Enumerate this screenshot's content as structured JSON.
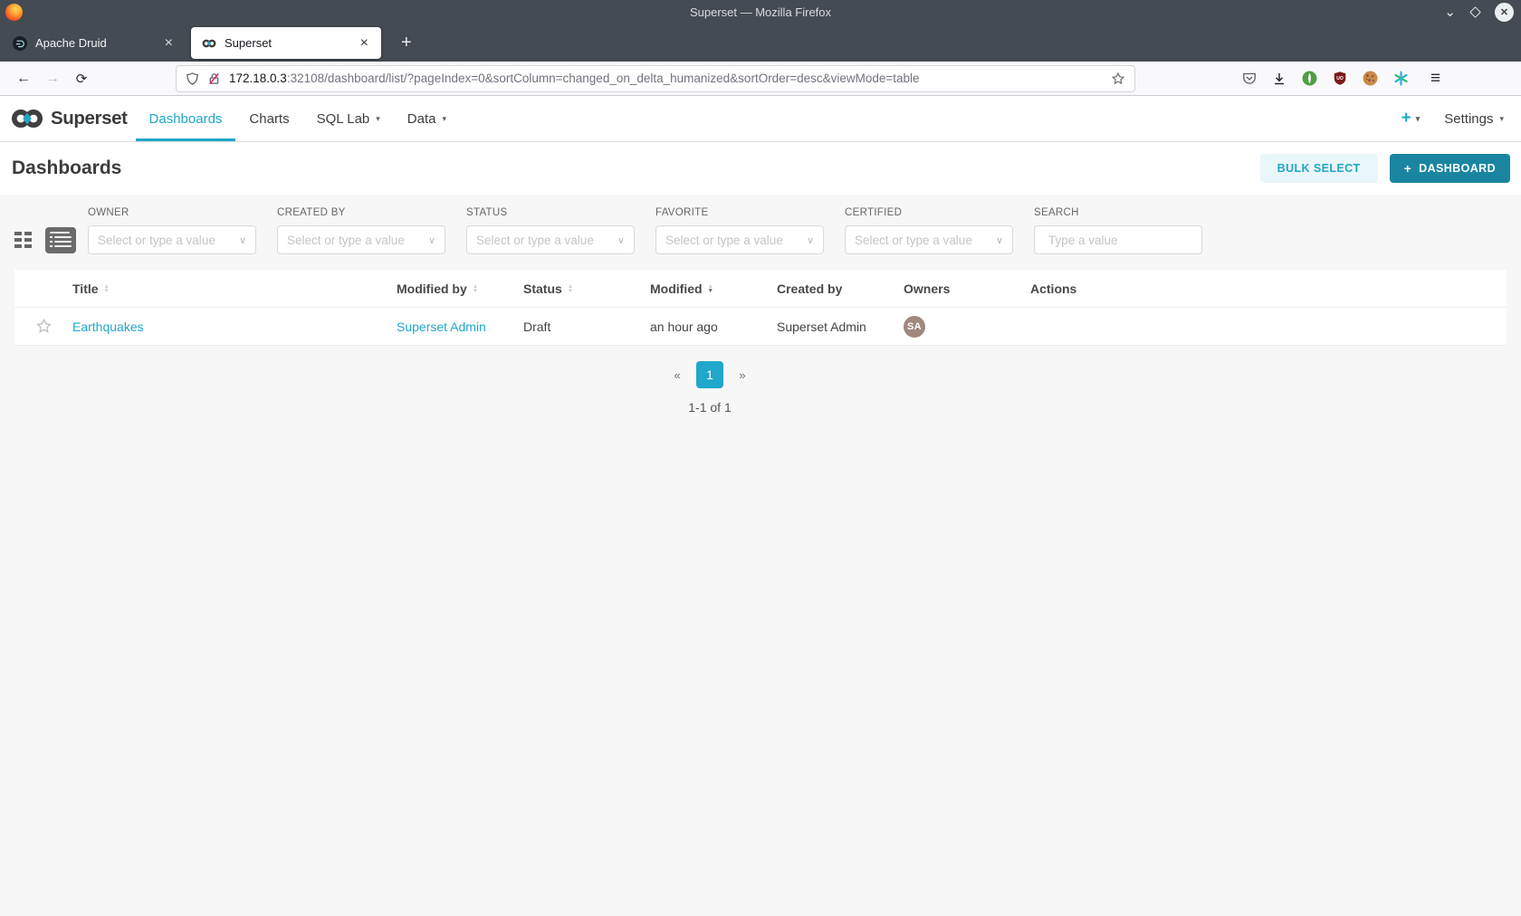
{
  "window": {
    "title": "Superset — Mozilla Firefox"
  },
  "icons": {
    "minimize": "⌄",
    "close": "✕",
    "tab_close": "×",
    "new_tab": "+",
    "back": "←",
    "forward": "→",
    "reload": "⟳",
    "hamburger": "≡",
    "caret_down": "▾",
    "select_chevron": "∨",
    "sort_asc": "▲",
    "sort_desc": "▼",
    "plus": "+",
    "prev": "«",
    "next": "»"
  },
  "browser": {
    "tabs": [
      {
        "label": "Apache Druid",
        "active": false
      },
      {
        "label": "Superset",
        "active": true
      }
    ],
    "urlbar": {
      "host": "172.18.0.3",
      "path": ":32108/dashboard/list/?pageIndex=0&sortColumn=changed_on_delta_humanized&sortOrder=desc&viewMode=table"
    }
  },
  "navbar": {
    "brand": "Superset",
    "items": [
      {
        "label": "Dashboards",
        "active": true
      },
      {
        "label": "Charts",
        "active": false
      },
      {
        "label": "SQL Lab",
        "active": false
      },
      {
        "label": "Data",
        "active": false
      }
    ],
    "settings_label": "Settings"
  },
  "page": {
    "title": "Dashboards",
    "bulk_select_label": "BULK SELECT",
    "new_dashboard_label": "DASHBOARD"
  },
  "filters": [
    {
      "label": "OWNER",
      "placeholder": "Select or type a value"
    },
    {
      "label": "CREATED BY",
      "placeholder": "Select or type a value"
    },
    {
      "label": "STATUS",
      "placeholder": "Select or type a value"
    },
    {
      "label": "FAVORITE",
      "placeholder": "Select or type a value"
    },
    {
      "label": "CERTIFIED",
      "placeholder": "Select or type a value"
    },
    {
      "label": "SEARCH",
      "placeholder": "Type a value"
    }
  ],
  "table": {
    "columns": [
      {
        "label": "Title",
        "sortable": true
      },
      {
        "label": "Modified by",
        "sortable": true
      },
      {
        "label": "Status",
        "sortable": true
      },
      {
        "label": "Modified",
        "sortable": true,
        "sorted": "desc"
      },
      {
        "label": "Created by",
        "sortable": false
      },
      {
        "label": "Owners",
        "sortable": false
      },
      {
        "label": "Actions",
        "sortable": false
      }
    ],
    "rows": [
      {
        "title": "Earthquakes",
        "modified_by": "Superset Admin",
        "status": "Draft",
        "modified": "an hour ago",
        "created_by": "Superset Admin",
        "owner_initials": "SA"
      }
    ]
  },
  "pagination": {
    "current_page": "1",
    "summary": "1-1 of 1"
  },
  "colors": {
    "accent": "#20A7C9",
    "accent_dark": "#1985A0",
    "avatar_bg": "#A1887F",
    "chrome_bg": "#454B52"
  }
}
